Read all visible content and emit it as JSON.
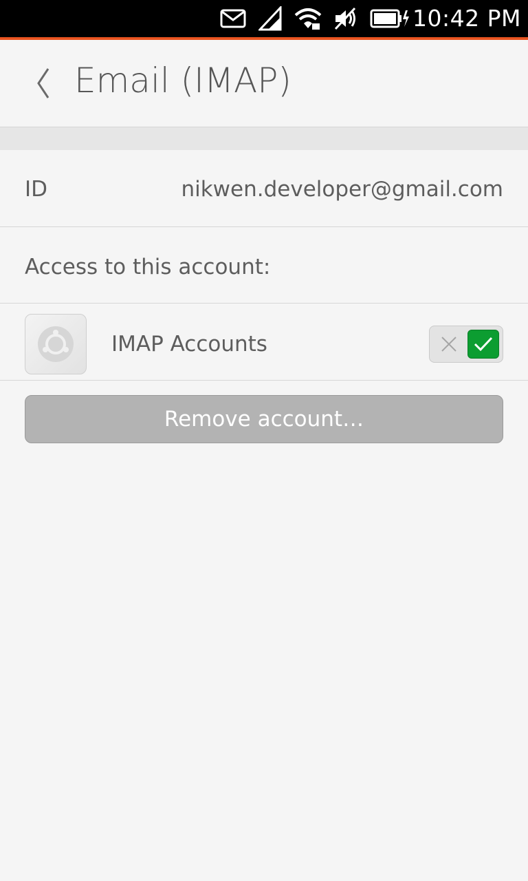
{
  "status_bar": {
    "time": "10:42 PM",
    "icons": [
      "mail-icon",
      "cellular-signal-icon",
      "wifi-icon",
      "muted-speaker-icon",
      "battery-charging-icon"
    ]
  },
  "header": {
    "title": "Email (IMAP)",
    "back_icon": "chevron-left-icon"
  },
  "account": {
    "id_label": "ID",
    "id_value": "nikwen.developer@gmail.com",
    "access_label": "Access to this account:",
    "apps": [
      {
        "name": "IMAP Accounts",
        "icon": "ubuntu-logo-icon",
        "enabled": true
      }
    ],
    "remove_button": "Remove account…"
  },
  "colors": {
    "accent": "#e95420",
    "toggle_on": "#0c9d31",
    "button": "#b3b3b3"
  }
}
